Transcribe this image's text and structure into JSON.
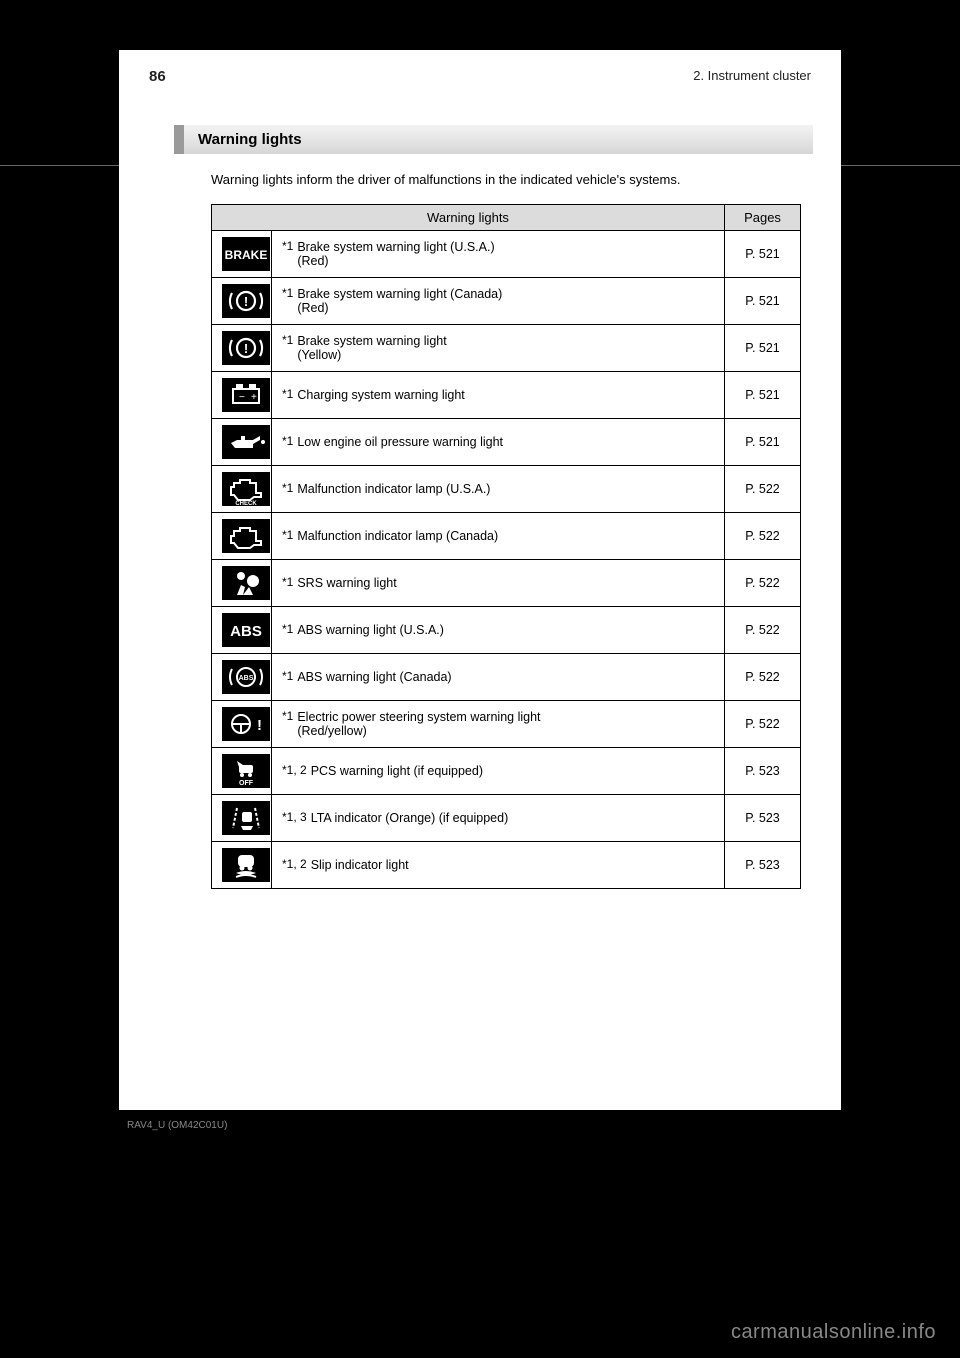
{
  "header": {
    "page_number": "86",
    "breadcrumb": "2. Instrument cluster"
  },
  "section": {
    "title": "Warning lights",
    "intro": "Warning lights inform the driver of malfunctions in the indicated vehicle's systems."
  },
  "table": {
    "col_label": "Warning lights",
    "col_pages": "Pages",
    "rows": [
      {
        "icon": "brake-text",
        "marker": "*1",
        "desc": "Brake system warning light (U.S.A.)\n(Red)",
        "page": "P. 521"
      },
      {
        "icon": "brake-circle",
        "marker": "*1",
        "desc": "Brake system warning light (Canada)\n(Red)",
        "page": "P. 521"
      },
      {
        "icon": "brake-circle",
        "marker": "*1",
        "desc": "Brake system warning light\n(Yellow)",
        "page": "P. 521"
      },
      {
        "icon": "battery",
        "marker": "*1",
        "desc": "Charging system warning light",
        "page": "P. 521"
      },
      {
        "icon": "oilcan",
        "marker": "*1",
        "desc": "Low engine oil pressure warning light",
        "page": "P. 521"
      },
      {
        "icon": "engine-check",
        "marker": "*1",
        "desc": "Malfunction indicator lamp (U.S.A.)",
        "page": "P. 522"
      },
      {
        "icon": "engine",
        "marker": "*1",
        "desc": "Malfunction indicator lamp (Canada)",
        "page": "P. 522"
      },
      {
        "icon": "airbag",
        "marker": "*1",
        "desc": "SRS warning light",
        "page": "P. 522"
      },
      {
        "icon": "abs-text",
        "marker": "*1",
        "desc": "ABS warning light (U.S.A.)",
        "page": "P. 522"
      },
      {
        "icon": "abs-circle",
        "marker": "*1",
        "desc": "ABS warning light (Canada)",
        "page": "P. 522"
      },
      {
        "icon": "steering",
        "marker": "*1",
        "desc": "Electric power steering system warning light\n(Red/yellow)",
        "page": "P. 522"
      },
      {
        "icon": "pcs-off",
        "marker": "*1, 2",
        "desc": "PCS warning light (if equipped)",
        "page": "P. 523"
      },
      {
        "icon": "lta",
        "marker": "*1, 3",
        "desc": "LTA indicator (Orange) (if equipped)",
        "page": "P. 523"
      },
      {
        "icon": "slip",
        "marker": "*1, 2",
        "desc": "Slip indicator light",
        "page": "P. 523"
      }
    ]
  },
  "footer": "RAV4_U (OM42C01U)",
  "watermark": "carmanualsonline.info"
}
